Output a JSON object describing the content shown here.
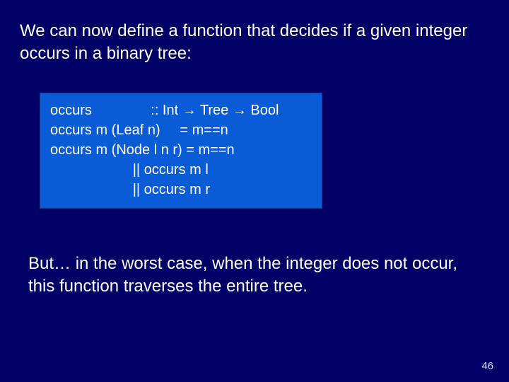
{
  "intro": "We can now define a function that decides if a given integer occurs in a binary tree:",
  "code": {
    "l1": "occurs               :: Int → Tree → Bool",
    "l2": "occurs m (Leaf n)     = m==n",
    "l3": "occurs m (Node l n r) = m==n",
    "l4": "                     || occurs m l",
    "l5": "                     || occurs m r"
  },
  "outro": "But… in the worst case, when the integer does not occur, this function traverses the entire tree.",
  "page": "46"
}
